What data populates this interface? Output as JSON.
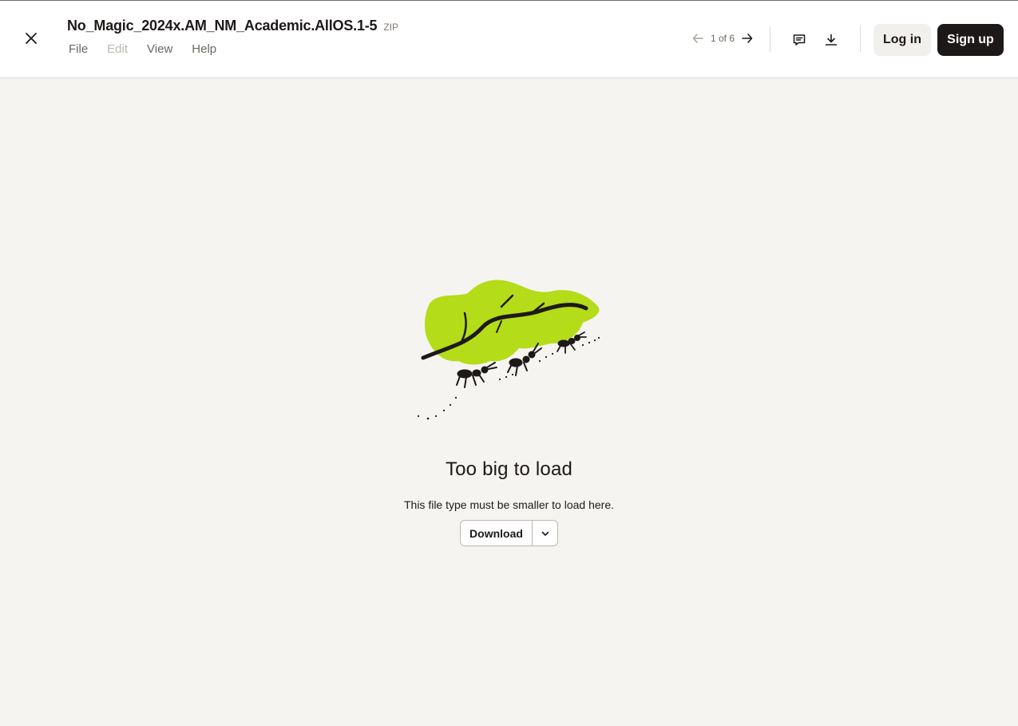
{
  "header": {
    "file_name": "No_Magic_2024x.AM_NM_Academic.AllOS.1-5",
    "file_ext": "ZIP",
    "menu": [
      {
        "label": "File",
        "enabled": true
      },
      {
        "label": "Edit",
        "enabled": false
      },
      {
        "label": "View",
        "enabled": true
      },
      {
        "label": "Help",
        "enabled": true
      }
    ],
    "pager": {
      "text": "1 of 6"
    },
    "login_label": "Log in",
    "signup_label": "Sign up"
  },
  "main": {
    "title": "Too big to load",
    "subtitle": "This file type must be smaller to load here.",
    "download_label": "Download"
  },
  "colors": {
    "background": "#f5f4f1",
    "leaf": "#b4dc19",
    "primary_dark": "#1e1919"
  },
  "icons": [
    "close-icon",
    "arrow-left-icon",
    "arrow-right-icon",
    "comment-icon",
    "download-icon",
    "chevron-down-icon",
    "leaf-ants-illustration"
  ]
}
